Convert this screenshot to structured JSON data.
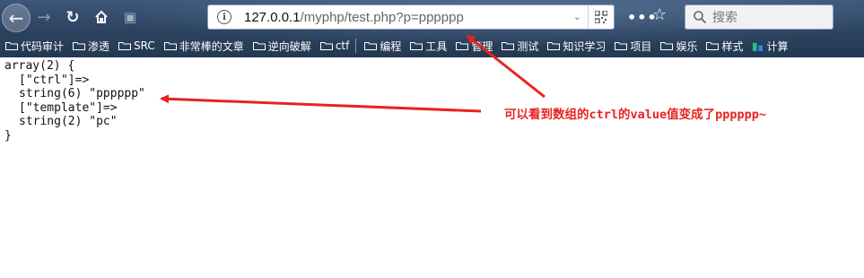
{
  "browser": {
    "url_host": "127.0.0.1",
    "url_rest": "/myphp/test.php?p=pppppp",
    "search_placeholder": "搜索",
    "menu_dots": "•••",
    "accent_color": "#2c4360"
  },
  "bookmarks": [
    {
      "label": "代码审计",
      "icon": "folder-icon"
    },
    {
      "label": "渗透",
      "icon": "folder-icon"
    },
    {
      "label": "SRC",
      "icon": "folder-icon"
    },
    {
      "label": "非常棒的文章",
      "icon": "folder-icon"
    },
    {
      "label": "逆向破解",
      "icon": "folder-icon"
    },
    {
      "label": "ctf",
      "icon": "folder-icon"
    },
    {
      "label": "编程",
      "icon": "folder-icon"
    },
    {
      "label": "工具",
      "icon": "folder-icon"
    },
    {
      "label": "管理",
      "icon": "folder-icon"
    },
    {
      "label": "测试",
      "icon": "folder-icon"
    },
    {
      "label": "知识学习",
      "icon": "folder-icon"
    },
    {
      "label": "项目",
      "icon": "folder-icon"
    },
    {
      "label": "娱乐",
      "icon": "folder-icon"
    },
    {
      "label": "样式",
      "icon": "folder-icon"
    },
    {
      "label": "计算",
      "icon": "gear-icon"
    }
  ],
  "output": {
    "line1": "array(2) {",
    "line2": "[\"ctrl\"]=>",
    "line3": "string(6) \"pppppp\"",
    "line4": "[\"template\"]=>",
    "line5": "string(2) \"pc\"",
    "line6": "}"
  },
  "annotation": {
    "text": "可以看到数组的ctrl的value值变成了pppppp~",
    "color": "#e8231f"
  }
}
